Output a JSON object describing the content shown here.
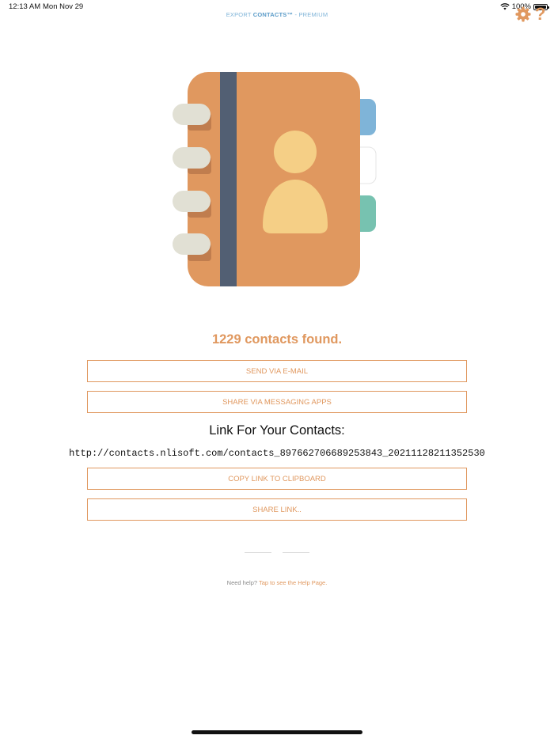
{
  "status_bar": {
    "time": "12:13 AM",
    "date": "Mon Nov 29",
    "battery": "100%"
  },
  "header": {
    "title_prefix": "EXPORT ",
    "title_strong": "CONTACTS™",
    "title_suffix": " - PREMIUM",
    "help_label": "?"
  },
  "main": {
    "contacts_found": "1229 contacts found.",
    "send_email_label": "SEND VIA E-MAIL",
    "share_messaging_label": "SHARE VIA MESSAGING APPS",
    "link_heading": "Link For Your Contacts:",
    "link_url": "http://contacts.nlisoft.com/contacts_897662706689253843_20211128211352530",
    "copy_link_label": "COPY LINK TO CLIPBOARD",
    "share_link_label": "SHARE LINK.."
  },
  "footer": {
    "need_help": "Need help?",
    "help_link": "Tap to see the Help Page."
  },
  "colors": {
    "accent": "#e0985f",
    "title_blue": "#7fb4d8",
    "book_cover": "#e0985f",
    "book_spine": "#525f73",
    "person": "#f5cf86"
  },
  "icons": [
    "wifi-icon",
    "battery-icon",
    "gear-icon",
    "help-icon",
    "address-book-icon"
  ]
}
